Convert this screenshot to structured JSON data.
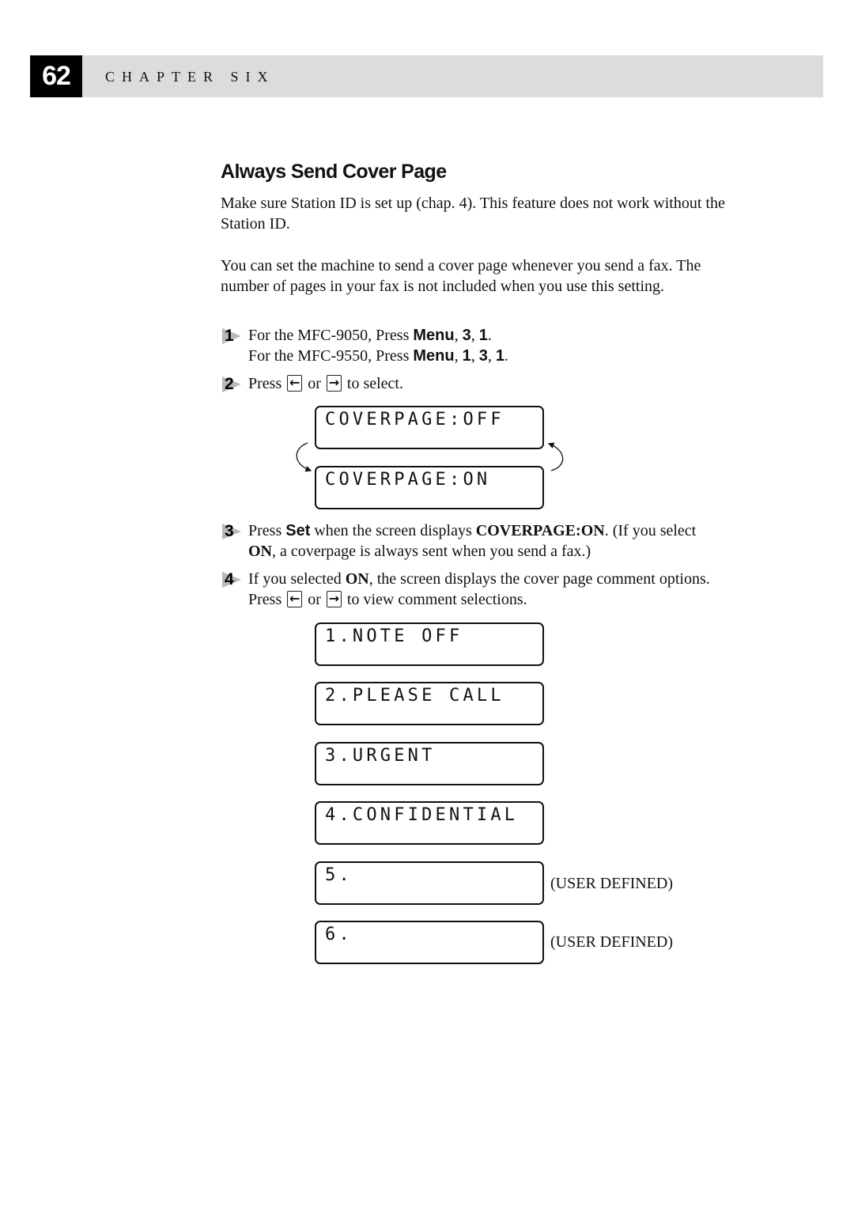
{
  "header": {
    "page_number": "62",
    "chapter_label": "CHAPTER SIX"
  },
  "section": {
    "title": "Always Send Cover Page",
    "paragraphs": [
      "Make sure Station ID is set up (chap. 4). This feature does not work without the Station ID.",
      "You can set the machine to send a cover page whenever you send a fax. The number of pages in your fax is not included when you use this setting."
    ]
  },
  "steps": [
    {
      "number": "1",
      "line1": {
        "pre": "For the MFC-9050, Press ",
        "key": "Menu",
        "post": ", ",
        "k1": "3",
        "sep": ", ",
        "k2": "1",
        "end": "."
      },
      "line2": {
        "pre": "For the MFC-9550, Press ",
        "key": "Menu",
        "post": ", ",
        "k1": "1",
        "sep1": ", ",
        "k2": "3",
        "sep2": ", ",
        "k3": "1",
        "end": "."
      }
    },
    {
      "number": "2",
      "pre": "Press ",
      "left_key_icon": "left-arrow-key",
      "left_key_glyph": "←",
      "mid": " or ",
      "right_key_icon": "right-arrow-key",
      "right_key_glyph": "→",
      "post": " to select."
    },
    {
      "number": "3",
      "t1": "Press ",
      "key": "Set",
      "t2": " when the screen displays ",
      "display": "COVERPAGE:ON",
      "t3": ". (If you select ",
      "on": "ON",
      "t4": ", a coverpage is always sent when you send a fax.)"
    },
    {
      "number": "4",
      "t1": "If you selected ",
      "on": "ON",
      "t2": ", the screen displays the cover page comment options. Press ",
      "left_key_glyph": "←",
      "mid": " or ",
      "right_key_glyph": "→",
      "post": " to view comment selections."
    }
  ],
  "lcd_toggle": [
    "COVERPAGE:OFF",
    "COVERPAGE:ON"
  ],
  "lcd_comments": [
    {
      "text": "1.NOTE OFF",
      "note": ""
    },
    {
      "text": "2.PLEASE CALL",
      "note": ""
    },
    {
      "text": "3.URGENT",
      "note": ""
    },
    {
      "text": "4.CONFIDENTIAL",
      "note": ""
    },
    {
      "text": "5.",
      "note": "(USER DEFINED)"
    },
    {
      "text": "6.",
      "note": "(USER DEFINED)"
    }
  ]
}
